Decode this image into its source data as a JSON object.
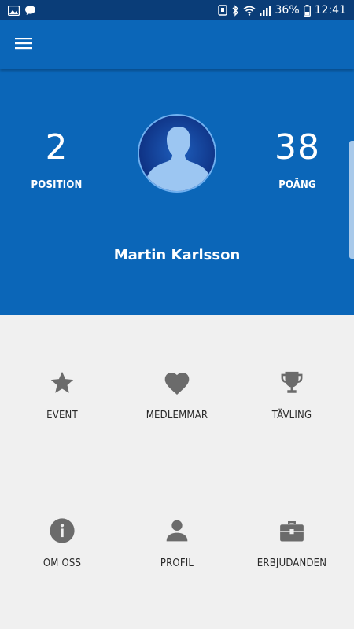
{
  "status_bar": {
    "battery": "36%",
    "time": "12:41",
    "icons": [
      "image-icon",
      "chat-bubble-icon",
      "nfc-icon",
      "bluetooth-icon",
      "wifi-icon",
      "signal-icon",
      "battery-icon"
    ]
  },
  "app_bar": {
    "menu_icon": "hamburger-menu-icon"
  },
  "profile": {
    "position_value": "2",
    "position_label": "POSITION",
    "points_value": "38",
    "points_label": "POÄNG",
    "name": "Martin Karlsson"
  },
  "menu": {
    "items": [
      {
        "label": "EVENT",
        "icon": "star-icon"
      },
      {
        "label": "MEDLEMMAR",
        "icon": "heart-icon"
      },
      {
        "label": "TÄVLING",
        "icon": "trophy-icon"
      },
      {
        "label": "OM OSS",
        "icon": "info-icon"
      },
      {
        "label": "PROFIL",
        "icon": "person-icon"
      },
      {
        "label": "ERBJUDANDEN",
        "icon": "briefcase-icon"
      }
    ]
  },
  "colors": {
    "primary": "#0b66b8",
    "status_bar": "#0a3d78",
    "background": "#f0f0f0",
    "icon": "#6b6b6b"
  }
}
